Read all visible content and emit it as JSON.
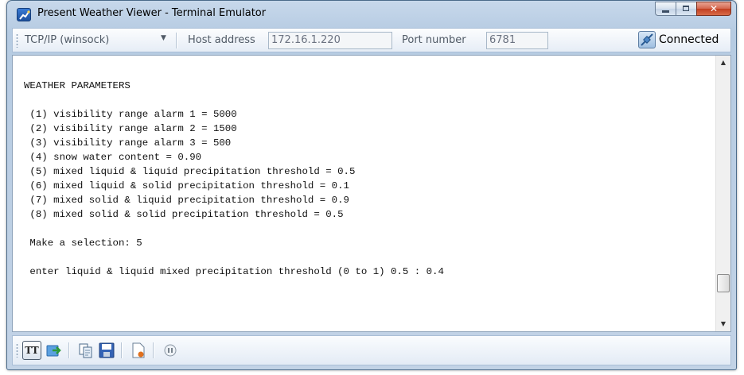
{
  "window": {
    "title": "Present Weather Viewer - Terminal Emulator"
  },
  "toolbar": {
    "protocol": "TCP/IP (winsock)",
    "host_label": "Host address",
    "host_value": "172.16.1.220",
    "port_label": "Port number",
    "port_value": "6781",
    "status": "Connected"
  },
  "terminal": {
    "lines": [
      "WEATHER PARAMETERS",
      "",
      " (1) visibility range alarm 1 = 5000",
      " (2) visibility range alarm 2 = 1500",
      " (3) visibility range alarm 3 = 500",
      " (4) snow water content = 0.90",
      " (5) mixed liquid & liquid precipitation threshold = 0.5",
      " (6) mixed liquid & solid precipitation threshold = 0.1",
      " (7) mixed solid & liquid precipitation threshold = 0.9",
      " (8) mixed solid & solid precipitation threshold = 0.5",
      "",
      " Make a selection: 5",
      "",
      " enter liquid & liquid mixed precipitation threshold (0 to 1) 0.5 : 0.4"
    ]
  },
  "bottom_toolbar": {
    "tt_label": "TT"
  },
  "icons": [
    "app-icon",
    "minimize-icon",
    "maximize-icon",
    "close-icon",
    "dropdown-arrow-icon",
    "connection-icon",
    "send-file-icon",
    "copy-icon",
    "save-icon",
    "log-file-icon",
    "pause-icon"
  ]
}
